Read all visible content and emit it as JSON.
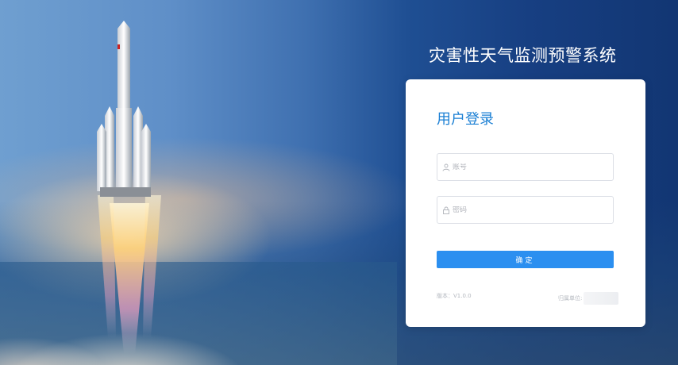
{
  "header": {
    "system_title": "灾害性天气监测预警系统"
  },
  "login": {
    "title": "用户登录",
    "username_placeholder": "账号",
    "password_placeholder": "密码",
    "submit_label": "确定",
    "version_text": "版本：V1.0.0",
    "unit_label": "归属单位:"
  },
  "icons": {
    "user": "user-icon",
    "lock": "lock-icon",
    "unit_logo": "unit-logo-image"
  },
  "colors": {
    "accent": "#1a7fd4",
    "button": "#2b8ff0",
    "background_dark": "#123673"
  }
}
